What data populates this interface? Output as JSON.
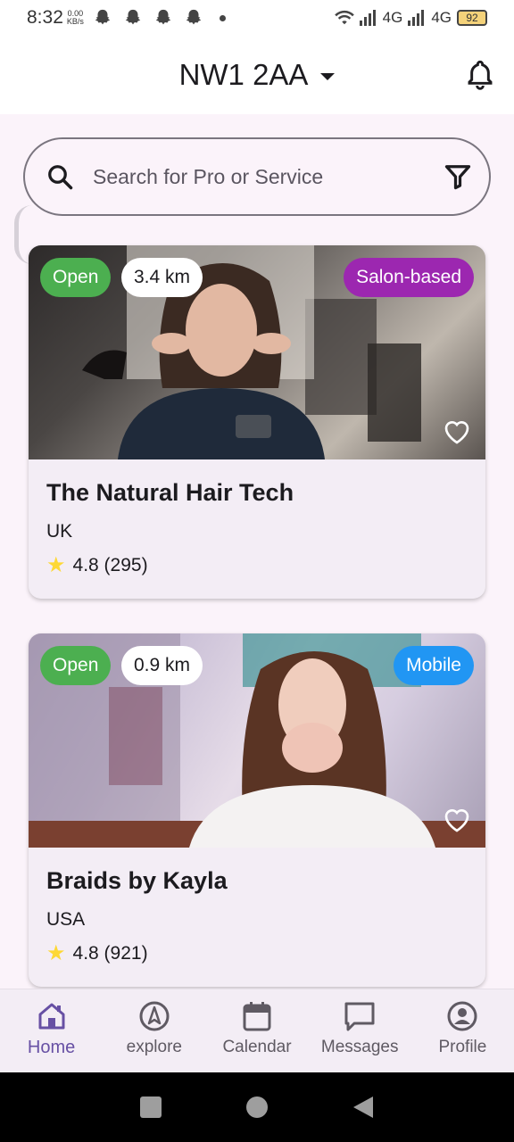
{
  "status_bar": {
    "time": "8:32",
    "speed_value": "0.00",
    "speed_unit": "KB/s",
    "network1": "4G",
    "network2": "4G",
    "battery": "92"
  },
  "header": {
    "location": "NW1 2AA",
    "icons": [
      "chevron-down-icon",
      "bell-icon"
    ]
  },
  "search": {
    "placeholder": "Search for Pro or Service",
    "value": "",
    "icons": [
      "search-icon",
      "filter-icon"
    ]
  },
  "listings": [
    {
      "status": "Open",
      "distance": "3.4 km",
      "type": "Salon-based",
      "type_color": "#9c27b0",
      "name": "The Natural Hair Tech",
      "country": "UK",
      "rating": "4.8 (295)"
    },
    {
      "status": "Open",
      "distance": "0.9 km",
      "type": "Mobile",
      "type_color": "#2196f3",
      "name": "Braids by Kayla",
      "country": "USA",
      "rating": "4.8 (921)"
    }
  ],
  "bottom_nav": {
    "items": [
      {
        "label": "Home",
        "icon": "home-icon",
        "active": true
      },
      {
        "label": "explore",
        "icon": "compass-icon",
        "active": false
      },
      {
        "label": "Calendar",
        "icon": "calendar-icon",
        "active": false
      },
      {
        "label": "Messages",
        "icon": "chat-icon",
        "active": false
      },
      {
        "label": "Profile",
        "icon": "profile-icon",
        "active": false
      }
    ]
  },
  "colors": {
    "accent": "#6750a4",
    "open_badge": "#4caf50",
    "star": "#fdd835"
  }
}
